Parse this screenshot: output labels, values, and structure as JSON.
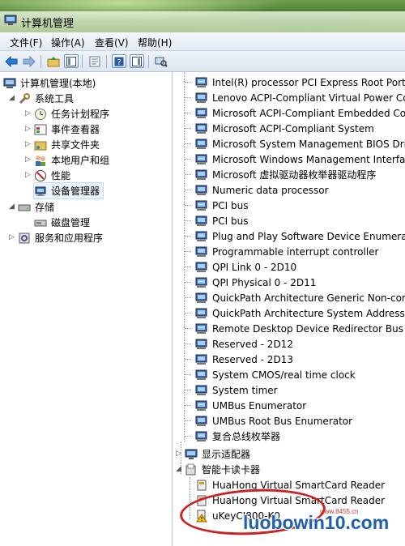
{
  "window": {
    "title": "计算机管理"
  },
  "menu": {
    "items": [
      "文件(F)",
      "操作(A)",
      "查看(V)",
      "帮助(H)"
    ]
  },
  "toolbar": {
    "icons": [
      "back-arrow-icon",
      "forward-arrow-icon",
      "up-folder-icon",
      "show-tree-icon",
      "properties-icon",
      "help-icon",
      "action-pane-icon",
      "scan-hardware-icon"
    ]
  },
  "left_tree": [
    {
      "label": "计算机管理(本地)",
      "icon": "computer-mgmt-icon",
      "level": 0,
      "expander": "none"
    },
    {
      "label": "系统工具",
      "icon": "tools-icon",
      "level": 1,
      "expander": "expanded"
    },
    {
      "label": "任务计划程序",
      "icon": "clock-icon",
      "level": 2,
      "expander": "collapsed"
    },
    {
      "label": "事件查看器",
      "icon": "event-viewer-icon",
      "level": 2,
      "expander": "collapsed"
    },
    {
      "label": "共享文件夹",
      "icon": "shared-folder-icon",
      "level": 2,
      "expander": "collapsed"
    },
    {
      "label": "本地用户和组",
      "icon": "users-icon",
      "level": 2,
      "expander": "collapsed"
    },
    {
      "label": "性能",
      "icon": "performance-icon",
      "level": 2,
      "expander": "collapsed"
    },
    {
      "label": "设备管理器",
      "icon": "device-manager-icon",
      "level": 2,
      "expander": "none",
      "selected": true
    },
    {
      "label": "存储",
      "icon": "storage-icon",
      "level": 1,
      "expander": "expanded"
    },
    {
      "label": "磁盘管理",
      "icon": "disk-icon",
      "level": 2,
      "expander": "none"
    },
    {
      "label": "服务和应用程序",
      "icon": "services-icon",
      "level": 1,
      "expander": "collapsed"
    }
  ],
  "right_list": [
    {
      "label": "Intel(R) processor PCI Express Root Port -",
      "icon": "device-icon"
    },
    {
      "label": "Lenovo ACPI-Compliant Virtual Power Con",
      "icon": "device-icon"
    },
    {
      "label": "Microsoft ACPI-Compliant Embedded Cont",
      "icon": "device-icon"
    },
    {
      "label": "Microsoft ACPI-Compliant System",
      "icon": "device-icon"
    },
    {
      "label": "Microsoft System Management BIOS Drive",
      "icon": "device-icon"
    },
    {
      "label": "Microsoft Windows Management Interface",
      "icon": "device-icon"
    },
    {
      "label": "Microsoft 虚拟驱动器枚举器驱动程序",
      "icon": "device-icon"
    },
    {
      "label": "Numeric data processor",
      "icon": "device-icon"
    },
    {
      "label": "PCI bus",
      "icon": "device-icon"
    },
    {
      "label": "PCI bus",
      "icon": "device-icon"
    },
    {
      "label": "Plug and Play Software Device Enumerator",
      "icon": "device-icon"
    },
    {
      "label": "Programmable interrupt controller",
      "icon": "device-icon"
    },
    {
      "label": "QPI Link 0 - 2D10",
      "icon": "device-icon"
    },
    {
      "label": "QPI Physical 0 - 2D11",
      "icon": "device-icon"
    },
    {
      "label": "QuickPath Architecture Generic Non-core",
      "icon": "device-icon"
    },
    {
      "label": "QuickPath Architecture System Address De",
      "icon": "device-icon"
    },
    {
      "label": "Remote Desktop Device Redirector Bus",
      "icon": "device-icon"
    },
    {
      "label": "Reserved - 2D12",
      "icon": "device-icon"
    },
    {
      "label": "Reserved - 2D13",
      "icon": "device-icon"
    },
    {
      "label": "System CMOS/real time clock",
      "icon": "device-icon"
    },
    {
      "label": "System timer",
      "icon": "device-icon"
    },
    {
      "label": "UMBus Enumerator",
      "icon": "device-icon"
    },
    {
      "label": "UMBus Root Bus Enumerator",
      "icon": "device-icon"
    },
    {
      "label": "复合总线枚举器",
      "icon": "device-icon"
    }
  ],
  "categories": [
    {
      "label": "显示适配器",
      "icon": "display-adapter-icon",
      "expander": "collapsed"
    },
    {
      "label": "智能卡读卡器",
      "icon": "smartcard-reader-icon",
      "expander": "expanded"
    }
  ],
  "smartcard_children": [
    {
      "label": "HuaHong Virtual SmartCard Reader",
      "icon": "smartcard-icon"
    },
    {
      "label": "HuaHong Virtual SmartCard Reader",
      "icon": "smartcard-icon"
    },
    {
      "label": "uKeyCI800-K0",
      "icon": "warning-device-icon",
      "warning": true
    }
  ],
  "watermark": {
    "text": "luobowin10.com",
    "sub": "www.8455.cn"
  }
}
